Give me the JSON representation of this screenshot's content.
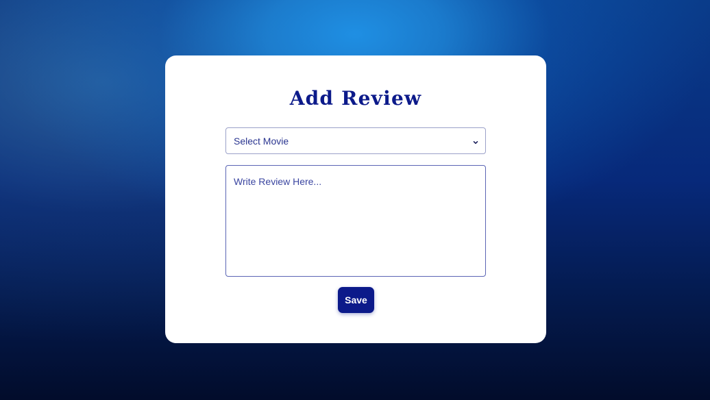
{
  "form": {
    "title": "Add Review",
    "movie_select": {
      "selected": "Select Movie",
      "icon": "chevron-down-icon"
    },
    "review_input": {
      "placeholder": "Write Review Here...",
      "value": ""
    },
    "save_label": "Save"
  },
  "colors": {
    "accent": "#0c1a8a",
    "card": "#ffffff",
    "background_top": "#1f8fe3",
    "background_bottom": "#020c2b"
  }
}
